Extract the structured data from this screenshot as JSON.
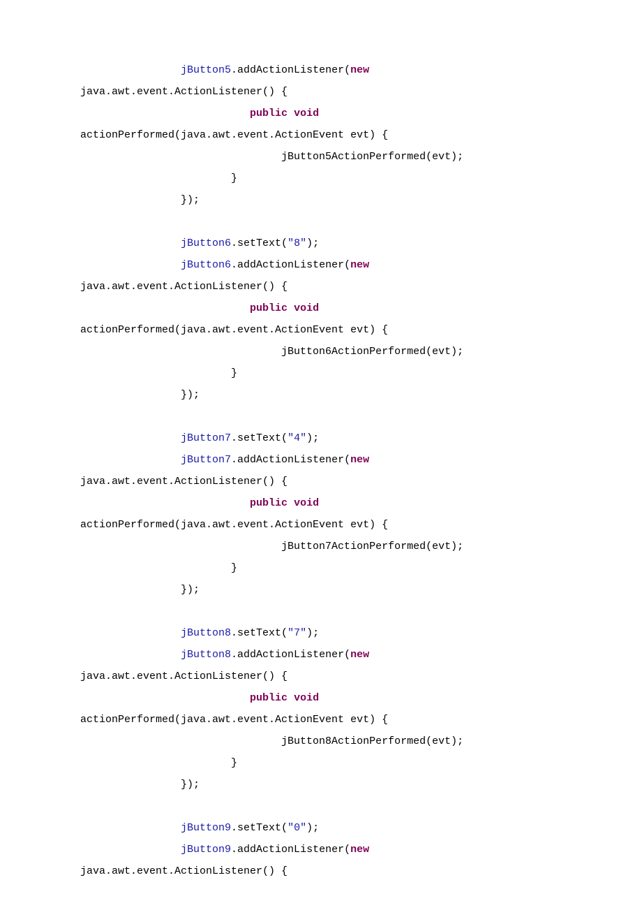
{
  "colors": {
    "identifier": "#1a1aa6",
    "string": "#1a1aa6",
    "keyword": "#7f0055",
    "default": "#000000"
  },
  "tokens": {
    "jButton5": "jButton5",
    "jButton6": "jButton6",
    "jButton7": "jButton7",
    "jButton8": "jButton8",
    "jButton9": "jButton9",
    "addActionListener": ".addActionListener(",
    "setText": ".setText(",
    "kw_new": "new",
    "kw_public": "public",
    "kw_void": "void",
    "actionListenerWrap": "java.awt.event.ActionListener() {",
    "actionPerformedSig": "actionPerformed(java.awt.event.ActionEvent evt) {",
    "jButton5Call": "jButton5ActionPerformed(evt);",
    "jButton6Call": "jButton6ActionPerformed(evt);",
    "jButton7Call": "jButton7ActionPerformed(evt);",
    "jButton8Call": "jButton8ActionPerformed(evt);",
    "closeBrace": "}",
    "closeBlock": "});",
    "closeParenSemi": ");",
    "str8": "\"8\"",
    "str4": "\"4\"",
    "str7": "\"7\"",
    "str0": "\"0\"",
    "space": " "
  },
  "indent": {
    "lvl2": "                ",
    "lvl3": "                        ",
    "lvl4": "                                ",
    "lvl4kw": "                           "
  }
}
